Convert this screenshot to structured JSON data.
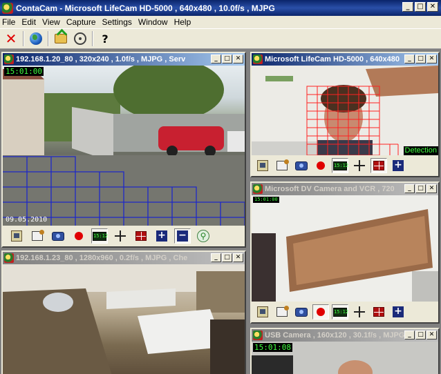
{
  "app": {
    "title": "ContaCam - Microsoft LifeCam HD-5000 , 640x480 , 10.0f/s , MJPG",
    "window_buttons": {
      "minimize": "_",
      "maximize": "□",
      "close": "✕"
    }
  },
  "menu": [
    "File",
    "Edit",
    "View",
    "Capture",
    "Settings",
    "Window",
    "Help"
  ],
  "toolbar": {
    "icons": [
      "close-icon",
      "globe-icon",
      "open-folder-icon",
      "settings-icon",
      "help-icon"
    ],
    "help_glyph": "?"
  },
  "child_buttons": {
    "minimize": "_",
    "maximize": "□",
    "close": "✕"
  },
  "cam_toolbar": {
    "osd_label": "15:12",
    "plus": "+",
    "minus": "−",
    "runner": "⚲"
  },
  "cameras": [
    {
      "title": "192.168.1.20_80 , 320x240 , 1.0f/s , MJPG , Serv",
      "time": "15:01:00",
      "date": "09.05.2010",
      "active": true
    },
    {
      "title": "Microsoft LifeCam HD-5000 , 640x480",
      "detection_label": "Detection",
      "active": true
    },
    {
      "title": "Microsoft DV Camera and VCR , 720",
      "time": "15:01:00",
      "active": false
    },
    {
      "title": "192.168.1.23_80 , 1280x960 , 0.2f/s , MJPG , Che",
      "active": false
    },
    {
      "title": "USB Camera , 160x120 , 30.1f/s , MJPG",
      "time": "15:01:08",
      "active": false
    }
  ]
}
